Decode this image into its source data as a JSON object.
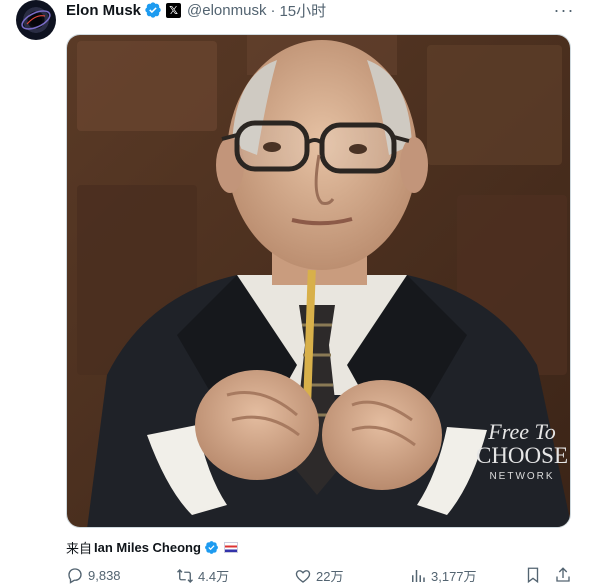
{
  "author": {
    "name": "Elon Musk",
    "handle": "@elonmusk",
    "separator": "·",
    "time": "15小时",
    "affiliate_badge": "𝕏"
  },
  "media": {
    "watermark_line1": "Free To",
    "watermark_line2": "CHOOSE",
    "watermark_line3": "NETWORK"
  },
  "source": {
    "prefix": "来自",
    "name": "Ian Miles Cheong"
  },
  "actions": {
    "replies": "9,838",
    "reposts": "4.4万",
    "likes": "22万",
    "views": "3,177万"
  },
  "colors": {
    "verified_blue": "#1d9bf0",
    "muted_text": "#536471"
  }
}
